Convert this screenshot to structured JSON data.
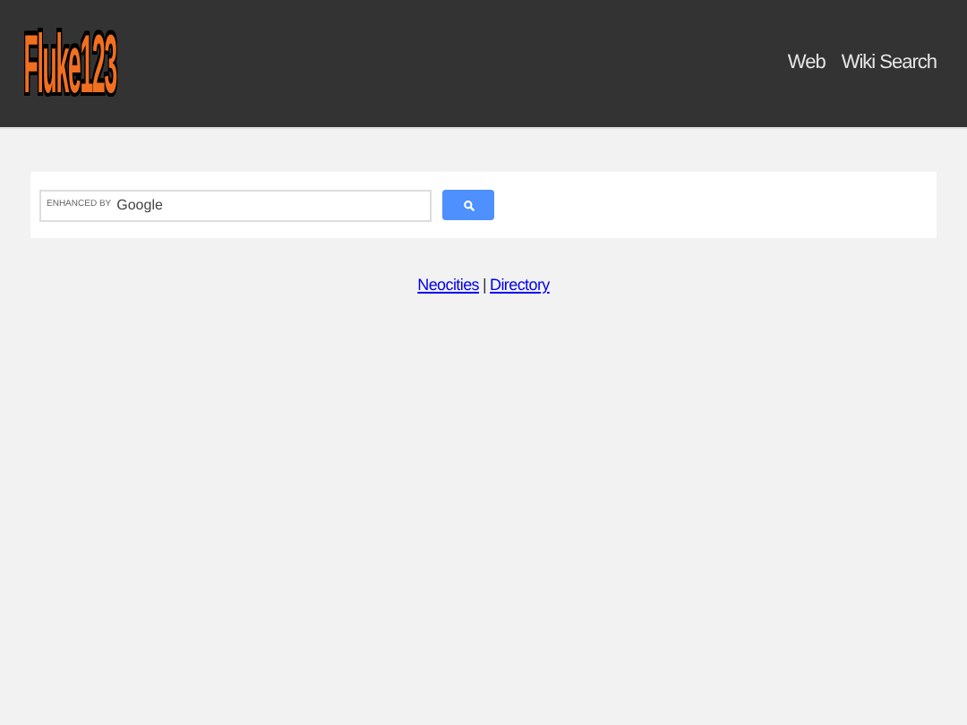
{
  "header": {
    "logo": "Fluke123",
    "nav": [
      "Web",
      "Wiki Search"
    ]
  },
  "search": {
    "branding_prefix": "ENHANCED BY",
    "branding_name": "Google"
  },
  "footer_links": [
    "Neocities",
    "Directory"
  ],
  "footer_separator": "|"
}
